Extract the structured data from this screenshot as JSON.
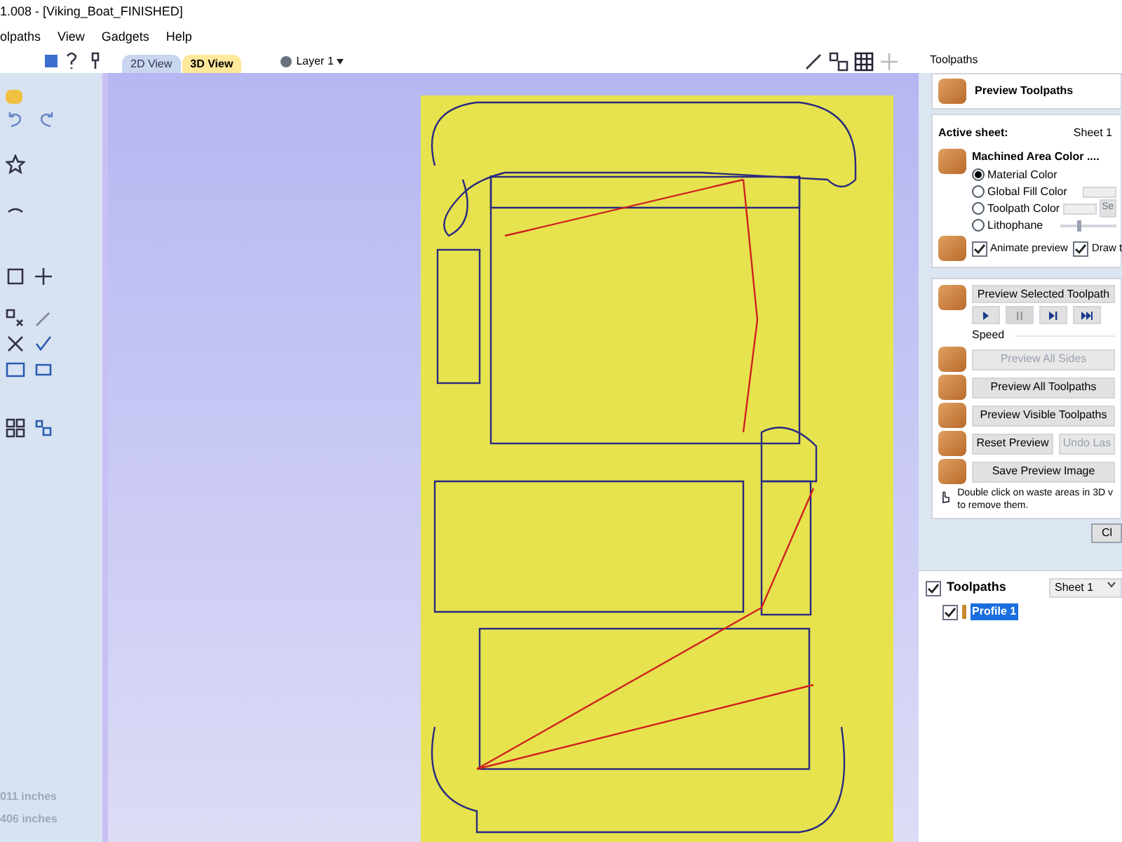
{
  "window": {
    "title": "1.008 - [Viking_Boat_FINISHED]"
  },
  "menu": [
    "olpaths",
    "View",
    "Gadgets",
    "Help"
  ],
  "view_tabs": [
    {
      "label": "2D View",
      "selected": false
    },
    {
      "label": "3D View",
      "selected": true
    }
  ],
  "layer": {
    "label": "Layer 1"
  },
  "left_panel": {
    "readouts": [
      "011 inches",
      "406 inches"
    ]
  },
  "toolpaths_panel": {
    "title": "Toolpaths",
    "header": "Preview Toolpaths",
    "active_sheet": {
      "label": "Active sheet:",
      "value": "Sheet 1"
    },
    "machined_area": {
      "heading": "Machined Area Color ....",
      "options": [
        {
          "label": "Material Color",
          "selected": true,
          "kind": "plain"
        },
        {
          "label": "Global Fill Color",
          "selected": false,
          "kind": "color"
        },
        {
          "label": "Toolpath Color",
          "selected": false,
          "kind": "color_button",
          "button": "Se"
        },
        {
          "label": "Lithophane",
          "selected": false,
          "kind": "slider",
          "level": 0.3
        }
      ]
    },
    "checks": [
      {
        "label": "Animate preview",
        "checked": true
      },
      {
        "label": "Draw t",
        "checked": true
      }
    ],
    "preview_selected": {
      "label": "Preview Selected Toolpath"
    },
    "transport": [
      {
        "kind": "play",
        "disabled": false
      },
      {
        "kind": "pause",
        "disabled": true
      },
      {
        "kind": "step",
        "disabled": false
      },
      {
        "kind": "end",
        "disabled": false
      }
    ],
    "speed_label": "Speed",
    "buttons": [
      {
        "label": "Preview All Sides",
        "disabled": true
      },
      {
        "label": "Preview All Toolpaths",
        "disabled": false
      },
      {
        "label": "Preview Visible Toolpaths",
        "disabled": false
      }
    ],
    "reset": {
      "label": "Reset Preview",
      "disabled": false
    },
    "undo": {
      "label": "Undo Las",
      "disabled": true
    },
    "save": {
      "label": "Save Preview Image",
      "disabled": false
    },
    "hint": "Double click on waste areas in 3D v to remove them.",
    "close": {
      "label": "Cl"
    }
  },
  "toolpath_list": {
    "title": "Toolpaths",
    "checked": true,
    "sheet": "Sheet 1",
    "items": [
      {
        "label": "Profile 1",
        "checked": true,
        "selected": true
      }
    ]
  }
}
